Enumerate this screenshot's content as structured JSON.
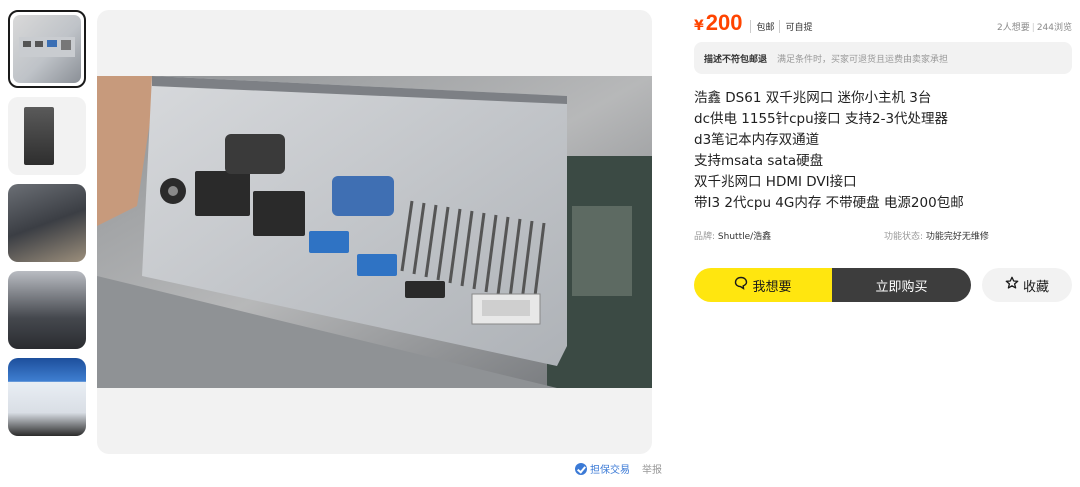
{
  "thumbnails": [
    {
      "label": "thumb-1",
      "active": true
    },
    {
      "label": "thumb-2",
      "active": false
    },
    {
      "label": "thumb-3",
      "active": false
    },
    {
      "label": "thumb-4",
      "active": false
    },
    {
      "label": "thumb-5",
      "active": false
    }
  ],
  "photo_footer": {
    "guarantee": "担保交易",
    "report": "举报"
  },
  "price": {
    "currency": "¥",
    "amount": "200",
    "tags": [
      "包邮",
      "可自提"
    ]
  },
  "stats": {
    "wants": "2人想要",
    "views": "244浏览"
  },
  "notice": {
    "title": "描述不符包邮退",
    "detail": "满足条件时，买家可退货且运费由卖家承担"
  },
  "description": [
    "浩鑫 DS61 双千兆网口 迷你小主机 3台",
    "dc供电 1155针cpu接口 支持2-3代处理器",
    "d3笔记本内存双通道",
    "支持msata sata硬盘",
    "双千兆网口 HDMI DVI接口",
    "带I3 2代cpu 4G内存 不带硬盘 电源200包邮"
  ],
  "attributes": [
    {
      "key": "品牌:",
      "value": "Shuttle/浩鑫"
    },
    {
      "key": "功能状态:",
      "value": "功能完好无维修"
    }
  ],
  "actions": {
    "want_label": "我想要",
    "buy_label": "立即购买",
    "favorite_label": "收藏"
  },
  "colors": {
    "price": "#ff4400",
    "want_button": "#ffe60f",
    "buy_button": "#3d3d3d",
    "guarantee": "#3b7ad6"
  },
  "icons": {
    "want": "chat-bubble-icon",
    "favorite": "star-icon",
    "guarantee": "shield-check-icon"
  }
}
